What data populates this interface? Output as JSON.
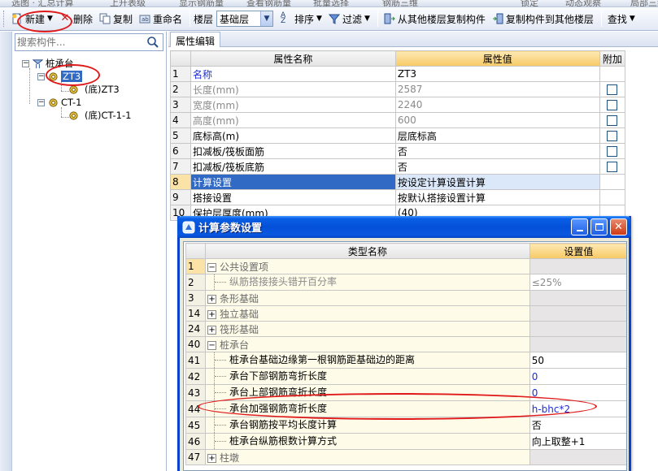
{
  "top_strip": [
    "选图 · 汇总计算",
    "上升表级",
    "显示钢筋量",
    "查看钢筋量",
    "批量选择",
    "钢筋三维",
    "锁定",
    "动态观察",
    "局部三维"
  ],
  "toolbar": {
    "new_label": "新建",
    "delete_label": "删除",
    "copy_label": "复制",
    "rename_label": "重命名",
    "floor_label": "楼层",
    "floor_value": "基础层",
    "sort_label": "排序",
    "filter_label": "过滤",
    "copy_from_floor_label": "从其他楼层复制构件",
    "copy_to_floor_label": "复制构件到其他楼层",
    "find_label": "查找"
  },
  "search": {
    "placeholder": "搜索构件..."
  },
  "tree": {
    "root": "桩承台",
    "items": [
      {
        "label": "ZT3",
        "child": "(底)ZT3"
      },
      {
        "label": "CT-1",
        "child": "(底)CT-1-1"
      }
    ]
  },
  "property_editor": {
    "tab": "属性编辑",
    "columns": [
      "",
      "属性名称",
      "属性值",
      "附加"
    ],
    "rows": [
      {
        "num": "1",
        "name": "名称",
        "value": "ZT3",
        "checkbox": false
      },
      {
        "num": "2",
        "name": "长度(mm)",
        "value": "2587",
        "checkbox": true
      },
      {
        "num": "3",
        "name": "宽度(mm)",
        "value": "2240",
        "checkbox": true
      },
      {
        "num": "4",
        "name": "高度(mm)",
        "value": "600",
        "checkbox": true
      },
      {
        "num": "5",
        "name": "底标高(m)",
        "value": "层底标高",
        "checkbox": true
      },
      {
        "num": "6",
        "name": "扣减板/筏板面筋",
        "value": "否",
        "checkbox": true
      },
      {
        "num": "7",
        "name": "扣减板/筏板底筋",
        "value": "否",
        "checkbox": true
      },
      {
        "num": "8",
        "name": "计算设置",
        "value": "按设定计算设置计算",
        "checkbox": false
      },
      {
        "num": "9",
        "name": "搭接设置",
        "value": "按默认搭接设置计算",
        "checkbox": false
      },
      {
        "num": "10",
        "name": "保护层厚度(mm)",
        "value": "(40)",
        "checkbox": false
      }
    ]
  },
  "dialog": {
    "title": "计算参数设置",
    "columns": [
      "",
      "类型名称",
      "设置值"
    ],
    "rows": [
      {
        "num": "1",
        "name": "公共设置项",
        "value": "",
        "kind": "group",
        "sign": "−"
      },
      {
        "num": "2",
        "name": "纵筋搭接接头错开百分率",
        "value": "≤25%",
        "kind": "child-gray"
      },
      {
        "num": "3",
        "name": "条形基础",
        "value": "",
        "kind": "group",
        "sign": "+"
      },
      {
        "num": "14",
        "name": "独立基础",
        "value": "",
        "kind": "group",
        "sign": "+"
      },
      {
        "num": "24",
        "name": "筏形基础",
        "value": "",
        "kind": "group",
        "sign": "+"
      },
      {
        "num": "40",
        "name": "桩承台",
        "value": "",
        "kind": "group",
        "sign": "−"
      },
      {
        "num": "41",
        "name": "桩承台基础边缘第一根钢筋距基础边的距离",
        "value": "50",
        "kind": "child"
      },
      {
        "num": "42",
        "name": "承台下部钢筋弯折长度",
        "value": "0",
        "kind": "child-blue"
      },
      {
        "num": "43",
        "name": "承台上部钢筋弯折长度",
        "value": "0",
        "kind": "child-blue"
      },
      {
        "num": "44",
        "name": "承台加强钢筋弯折长度",
        "value": "h-bhc*2",
        "kind": "child-blue"
      },
      {
        "num": "45",
        "name": "承台钢筋按平均长度计算",
        "value": "否",
        "kind": "child"
      },
      {
        "num": "46",
        "name": "桩承台纵筋根数计算方式",
        "value": "向上取整+1",
        "kind": "child"
      },
      {
        "num": "47",
        "name": "柱墩",
        "value": "",
        "kind": "group",
        "sign": "+"
      }
    ]
  },
  "colors": {
    "annotation": "#e01a1a",
    "title_bar": "#0450d8",
    "selection": "#316ac5",
    "header_gold": "#f7c964"
  }
}
